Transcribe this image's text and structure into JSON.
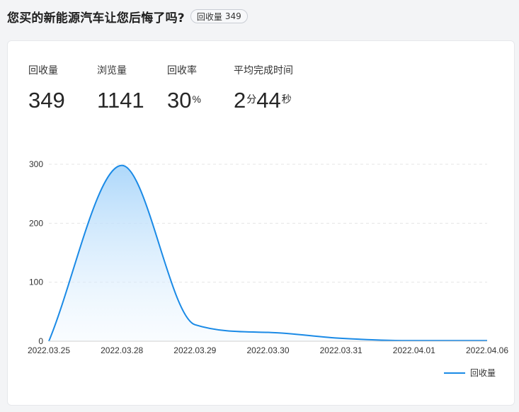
{
  "header": {
    "title": "您买的新能源汽车让您后悔了吗?",
    "badge_label": "回收量",
    "badge_value": "349"
  },
  "stats": [
    {
      "label": "回收量",
      "value": "349",
      "unit": ""
    },
    {
      "label": "浏览量",
      "value": "1141",
      "unit": ""
    },
    {
      "label": "回收率",
      "value": "30",
      "unit": "%"
    },
    {
      "label": "平均完成时间",
      "value": "2",
      "unit": "分",
      "value2": "44",
      "unit2": "秒"
    }
  ],
  "chart_data": {
    "type": "area",
    "title": "",
    "xlabel": "",
    "ylabel": "",
    "x": [
      "2022.03.25",
      "2022.03.28",
      "2022.03.29",
      "2022.03.30",
      "2022.03.31",
      "2022.04.01",
      "2022.04.06"
    ],
    "series": [
      {
        "name": "回收量",
        "values": [
          0,
          298,
          28,
          15,
          5,
          1,
          1
        ]
      }
    ],
    "ylim": [
      0,
      300
    ],
    "yticks": [
      0,
      100,
      200,
      300
    ],
    "grid": true,
    "legend": "bottom-right",
    "colors": {
      "line": "#1a8ae6",
      "fill_top": "#b3dafa",
      "grid": "#e5e5e5"
    }
  }
}
